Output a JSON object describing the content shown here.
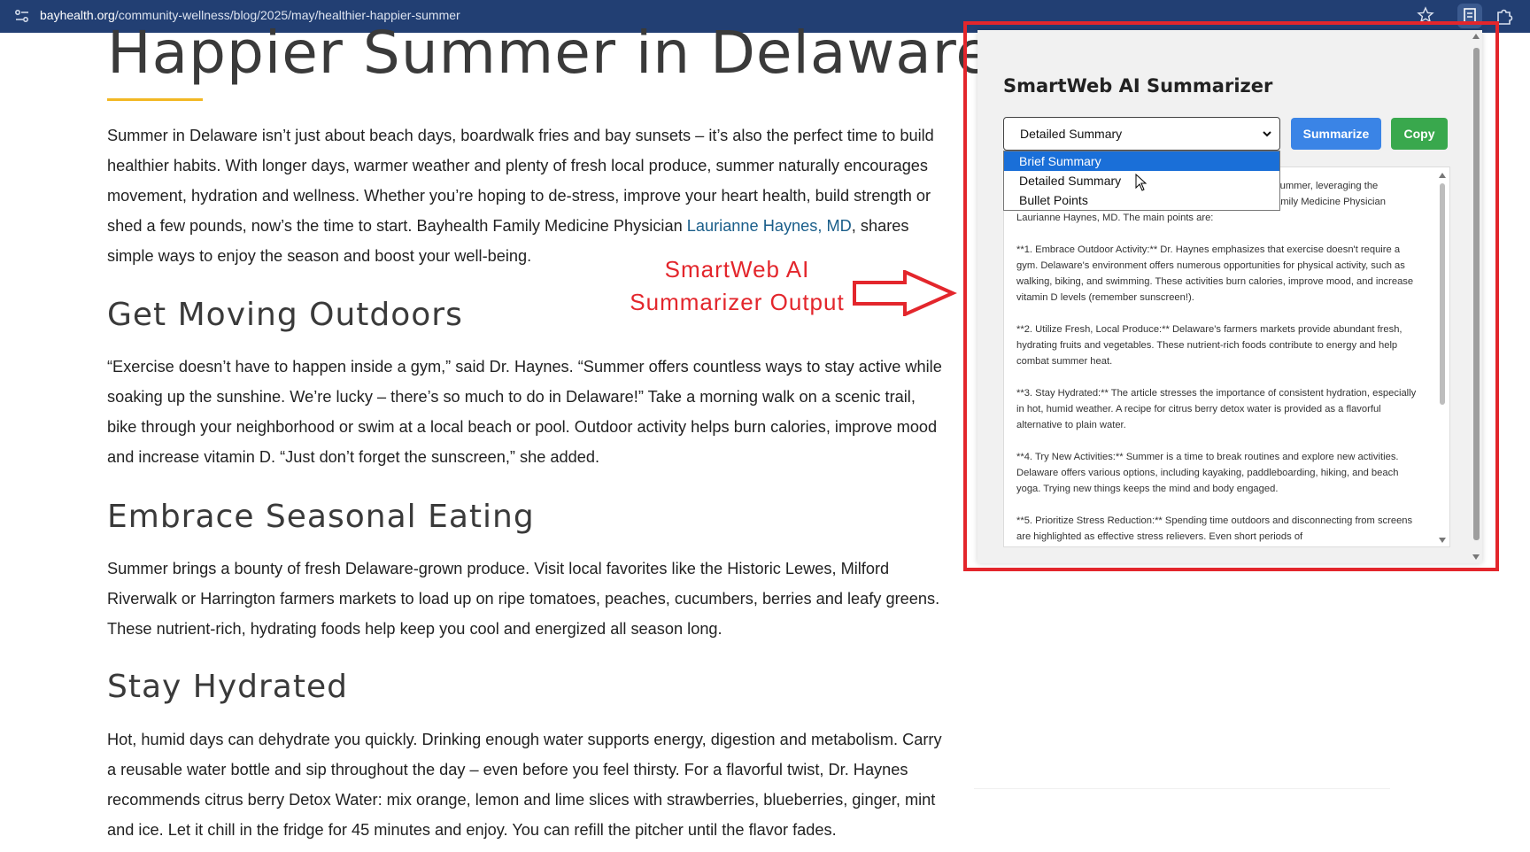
{
  "browser": {
    "url_domain": "bayhealth.org",
    "url_path": "/community-wellness/blog/2025/may/healthier-happier-summer"
  },
  "article": {
    "title_visible": "Happier Summer in Delaware",
    "intro_1": "Summer in Delaware isn’t just about beach days, boardwalk fries and bay sunsets – it’s also the perfect time to build healthier habits. With longer days, warmer weather and plenty of fresh local produce, summer naturally encourages movement, hydration and wellness. Whether you’re hoping to de-stress, improve your heart health, build strength or shed a few pounds, now’s the time to start. Bayhealth Family Medicine Physician ",
    "intro_link": "Laurianne Haynes, MD",
    "intro_2": ", shares simple ways to enjoy the season and boost your well-being.",
    "sections": [
      {
        "heading": "Get Moving Outdoors",
        "body": "“Exercise doesn’t have to happen inside a gym,” said Dr. Haynes. “Summer offers countless ways to stay active while soaking up the sunshine. We’re lucky – there’s so much to do in Delaware!” Take a morning walk on a scenic trail, bike through your neighborhood or swim at a local beach or pool. Outdoor activity helps burn calories, improve mood and increase vitamin D. “Just don’t forget the sunscreen,” she added."
      },
      {
        "heading": "Embrace Seasonal Eating",
        "body": "Summer brings a bounty of fresh Delaware-grown produce. Visit local favorites like the Historic Lewes, Milford Riverwalk or Harrington farmers markets to load up on ripe tomatoes, peaches, cucumbers, berries and leafy greens. These nutrient-rich, hydrating foods help keep you cool and energized all season long."
      },
      {
        "heading": "Stay Hydrated",
        "body": "Hot, humid days can dehydrate you quickly. Drinking enough water supports energy, digestion and metabolism. Carry a reusable water bottle and sip throughout the day – even before you feel thirsty. For a flavorful twist, Dr. Haynes recommends citrus berry Detox Water: mix orange, lemon and lime slices with strawberries, blueberries, ginger, mint and ice. Let it chill in the fridge for 45 minutes and enjoy. You can refill the pitcher until the flavor fades."
      }
    ]
  },
  "annotation": {
    "line1": "SmartWeb AI",
    "line2": "Summarizer Output",
    "color": "#e3262c"
  },
  "popup": {
    "title": "SmartWeb AI Summarizer",
    "selected_mode": "Detailed Summary",
    "summarize_label": "Summarize",
    "copy_label": "Copy",
    "options": [
      "Brief Summary",
      "Detailed Summary",
      "Bullet Points"
    ],
    "highlighted_option": "Brief Summary",
    "output": {
      "intro_line1_tail": "summer, leveraging the",
      "intro_line2_tail": "amily Medicine Physician",
      "intro_line3": "Laurianne Haynes, MD.  The main points are:",
      "points": [
        "**1. Embrace Outdoor Activity:** Dr. Haynes emphasizes that exercise doesn't require a gym. Delaware's environment offers numerous opportunities for physical activity, such as walking, biking, and swimming.  These activities burn calories, improve mood, and increase vitamin D levels (remember sunscreen!).",
        "**2. Utilize Fresh, Local Produce:**  Delaware's farmers markets provide abundant fresh, hydrating fruits and vegetables.  These nutrient-rich foods contribute to energy and help combat summer heat.",
        "**3. Stay Hydrated:**  The article stresses the importance of consistent hydration, especially in hot, humid weather.  A recipe for citrus berry detox water is provided as a flavorful alternative to plain water.",
        "**4. Try New Activities:** Summer is a time to break routines and explore new activities.  Delaware offers various options, including kayaking, paddleboarding, hiking, and beach yoga.  Trying new things keeps the mind and body engaged.",
        "**5. Prioritize Stress Reduction:**  Spending time outdoors and disconnecting from screens are highlighted as effective stress relievers.  Even short periods of"
      ]
    }
  },
  "colors": {
    "browser_bar": "#223f73",
    "accent_rule": "#f2b824",
    "link": "#1a5e8a",
    "summarize_btn": "#3a84e6",
    "copy_btn": "#39a84d",
    "dropdown_highlight": "#1a6fd8"
  }
}
